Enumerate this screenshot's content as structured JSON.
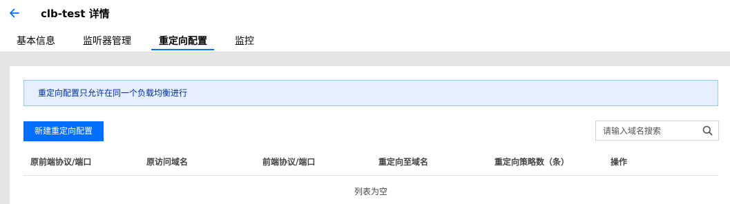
{
  "header": {
    "title": "clb-test 详情",
    "back_icon": "arrow-left-icon"
  },
  "tabs": [
    {
      "label": "基本信息",
      "active": false
    },
    {
      "label": "监听器管理",
      "active": false
    },
    {
      "label": "重定向配置",
      "active": true
    },
    {
      "label": "监控",
      "active": false
    }
  ],
  "notice": {
    "text": "重定向配置只允许在同一个负载均衡进行"
  },
  "toolbar": {
    "create_label": "新建重定向配置",
    "search_placeholder": "请输入域名搜索",
    "search_value": ""
  },
  "table": {
    "columns": [
      "原前端协议/端口",
      "原访问域名",
      "前端协议/端口",
      "重定向至域名",
      "重定向策略数（条）",
      "操作"
    ],
    "rows": [],
    "empty_text": "列表为空"
  },
  "colors": {
    "accent": "#006eff",
    "notice_bg": "#e5efff",
    "notice_border": "#97c7ff",
    "page_bg": "#e5e5e5"
  }
}
